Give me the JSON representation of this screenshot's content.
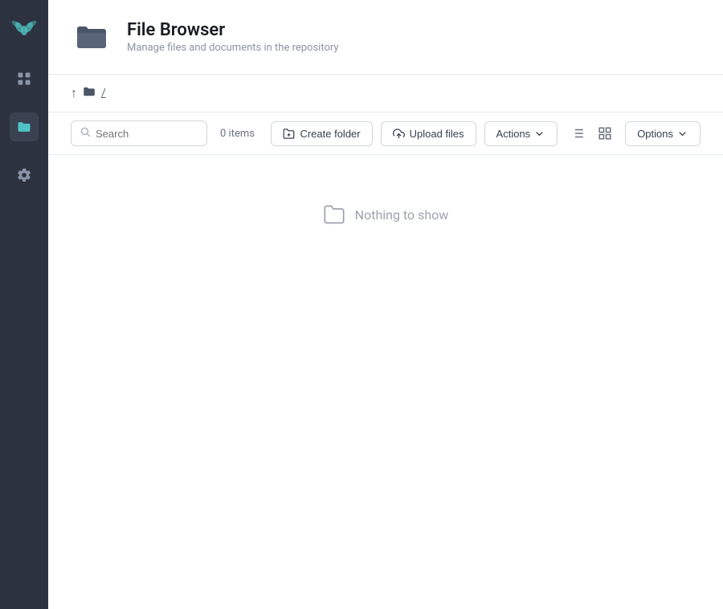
{
  "sidebar": {
    "logo_label": "Logo",
    "items": [
      {
        "id": "dashboard",
        "label": "Dashboard",
        "icon": "grid-icon",
        "active": false
      },
      {
        "id": "files",
        "label": "Files",
        "icon": "folder-icon",
        "active": true
      },
      {
        "id": "settings",
        "label": "Settings",
        "icon": "gear-icon",
        "active": false
      }
    ]
  },
  "page_header": {
    "title": "File Browser",
    "subtitle": "Manage files and documents in the repository",
    "icon_label": "folder-large-icon"
  },
  "breadcrumb": {
    "up_label": "↑",
    "folder_label": "📁",
    "path_label": "/"
  },
  "toolbar": {
    "search_placeholder": "Search",
    "items_count": "0 items",
    "create_folder_label": "Create folder",
    "upload_files_label": "Upload files",
    "actions_label": "Actions",
    "options_label": "Options",
    "list_view_label": "List view",
    "grid_view_label": "Grid view"
  },
  "empty_state": {
    "message": "Nothing to show"
  },
  "colors": {
    "sidebar_bg": "#2c3240",
    "accent": "#4fc3c3",
    "folder_dark": "#4a5568"
  }
}
